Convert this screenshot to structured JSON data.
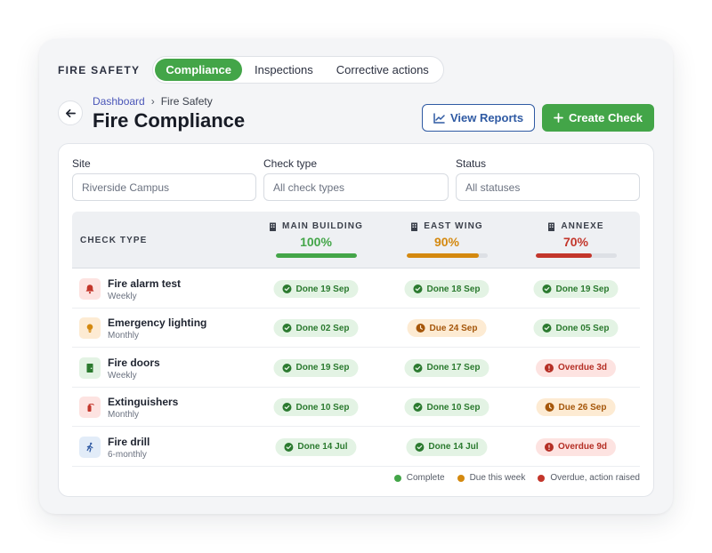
{
  "brand": "FIRE SAFETY",
  "tabs": [
    {
      "label": "Compliance",
      "active": true
    },
    {
      "label": "Inspections",
      "active": false
    },
    {
      "label": "Corrective actions",
      "active": false
    }
  ],
  "breadcrumb": {
    "parent": "Dashboard",
    "separator": "›",
    "current": "Fire Safety"
  },
  "page_title": "Fire Compliance",
  "buttons": {
    "view_reports": "View Reports",
    "create_check": "Create Check"
  },
  "filters": {
    "site": {
      "label": "Site",
      "value": "Riverside Campus"
    },
    "check_type": {
      "label": "Check type",
      "placeholder": "All check types"
    },
    "status": {
      "label": "Status",
      "placeholder": "All statuses"
    }
  },
  "table": {
    "type_header": "CHECK TYPE",
    "columns": [
      {
        "name": "MAIN BUILDING",
        "percent_label": "100%",
        "percent": 100,
        "color": "#43a548"
      },
      {
        "name": "EAST WING",
        "percent_label": "90%",
        "percent": 90,
        "color": "#d4890f"
      },
      {
        "name": "ANNEXE",
        "percent_label": "70%",
        "percent": 70,
        "color": "#c3362b"
      }
    ],
    "rows": [
      {
        "name": "Fire alarm test",
        "frequency": "Weekly",
        "icon": "bell-icon",
        "cells": [
          {
            "status": "done",
            "text": "Done 19 Sep"
          },
          {
            "status": "done",
            "text": "Done 18 Sep"
          },
          {
            "status": "done",
            "text": "Done 19 Sep"
          }
        ]
      },
      {
        "name": "Emergency lighting",
        "frequency": "Monthly",
        "icon": "lightbulb-icon",
        "cells": [
          {
            "status": "done",
            "text": "Done 02 Sep"
          },
          {
            "status": "due",
            "text": "Due 24 Sep"
          },
          {
            "status": "done",
            "text": "Done 05 Sep"
          }
        ]
      },
      {
        "name": "Fire doors",
        "frequency": "Weekly",
        "icon": "door-icon",
        "cells": [
          {
            "status": "done",
            "text": "Done 19 Sep"
          },
          {
            "status": "done",
            "text": "Done 17 Sep"
          },
          {
            "status": "over",
            "text": "Overdue 3d"
          }
        ]
      },
      {
        "name": "Extinguishers",
        "frequency": "Monthly",
        "icon": "extinguisher-icon",
        "cells": [
          {
            "status": "done",
            "text": "Done 10 Sep"
          },
          {
            "status": "done",
            "text": "Done 10 Sep"
          },
          {
            "status": "due",
            "text": "Due 26 Sep"
          }
        ]
      },
      {
        "name": "Fire drill",
        "frequency": "6-monthly",
        "icon": "running-person-icon",
        "cells": [
          {
            "status": "done",
            "text": "Done 14 Jul"
          },
          {
            "status": "done",
            "text": "Done 14 Jul"
          },
          {
            "status": "over",
            "text": "Overdue 9d"
          }
        ]
      }
    ]
  },
  "legend": [
    {
      "label": "Complete",
      "color": "#43a548"
    },
    {
      "label": "Due this week",
      "color": "#d4890f"
    },
    {
      "label": "Overdue, action raised",
      "color": "#c3362b"
    }
  ]
}
